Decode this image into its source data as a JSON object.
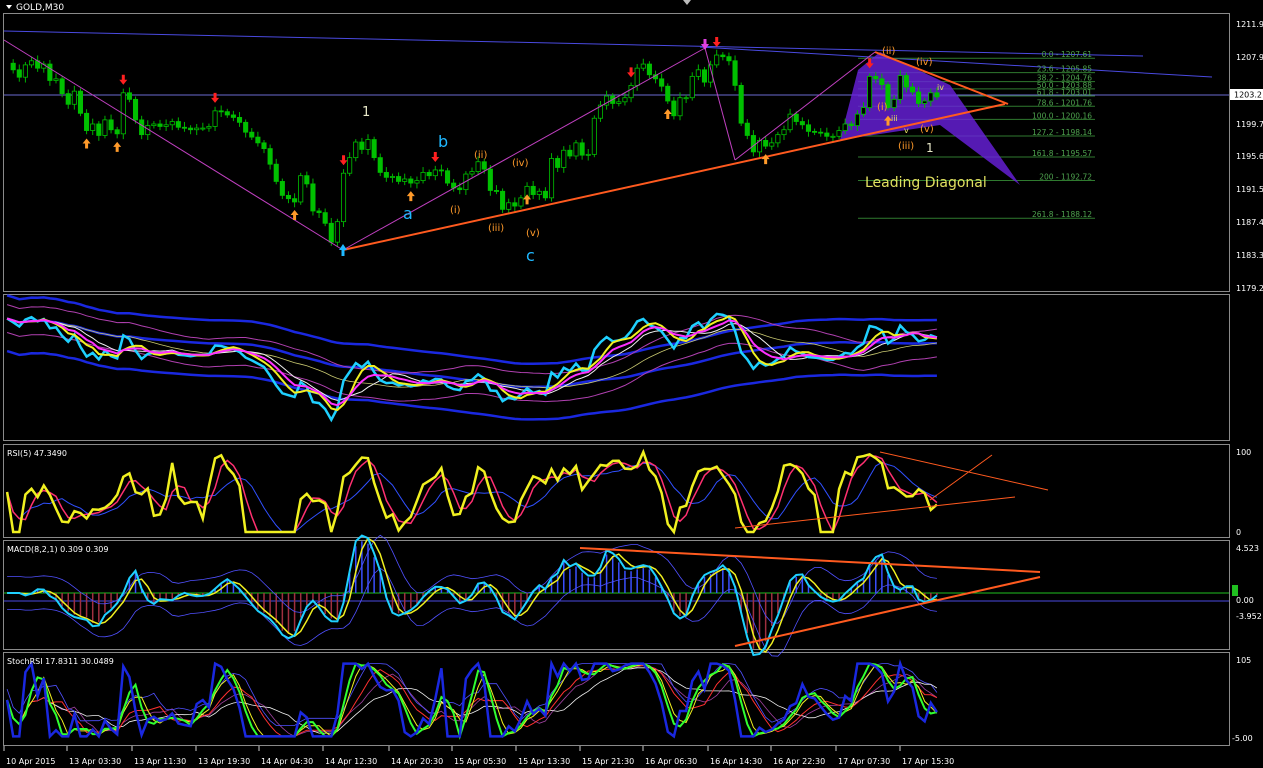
{
  "header": {
    "symbol": "GOLD,M30"
  },
  "price_axis": {
    "ticks": [
      "1211.95",
      "1207.95",
      "1203.2",
      "1199.75",
      "1195.65",
      "1191.55",
      "1187.45",
      "1183.35",
      "1179.25"
    ],
    "current_price": "1203.2"
  },
  "indicators": {
    "rsi": {
      "label": "RSI(5) 47.3490",
      "ticks": [
        "100",
        "0"
      ]
    },
    "macd": {
      "label": "MACD(8,2,1) 0.309 0.309",
      "ticks": [
        "4.523",
        "0.00",
        "-3.952"
      ]
    },
    "stoch": {
      "label": "StochRSI 17.8311 30.0489",
      "ticks": [
        "105",
        "-5.00"
      ]
    }
  },
  "time_axis": {
    "labels": [
      "10 Apr 2015",
      "13 Apr 03:30",
      "13 Apr 11:30",
      "13 Apr 19:30",
      "14 Apr 04:30",
      "14 Apr 12:30",
      "14 Apr 20:30",
      "15 Apr 05:30",
      "15 Apr 13:30",
      "15 Apr 21:30",
      "16 Apr 06:30",
      "16 Apr 14:30",
      "16 Apr 22:30",
      "17 Apr 07:30",
      "17 Apr 15:30"
    ]
  },
  "fib_levels": [
    {
      "label": "0.0 - 1207.61"
    },
    {
      "label": "23.6 - 1205.85"
    },
    {
      "label": "38.2 - 1204.76"
    },
    {
      "label": "50.0 - 1203.88"
    },
    {
      "label": "61.8 - 1203.01"
    },
    {
      "label": "78.6 - 1201.76"
    },
    {
      "label": "100.0 - 1200.16"
    },
    {
      "label": "127.2 - 1198.14"
    },
    {
      "label": "161.8 - 1195.57"
    },
    {
      "label": "200 - 1192.72"
    },
    {
      "label": "261.8 - 1188.12"
    }
  ],
  "wave_labels": {
    "one_a": "1",
    "b": "b",
    "a": "a",
    "c": "c",
    "i": "(i)",
    "ii": "(ii)",
    "iii": "(iii)",
    "iv": "(iv)",
    "v": "(v)",
    "r_ii": "(ii)",
    "r_iv": "(iv)",
    "r_i": "(i)",
    "r_iii": "(iii)",
    "r_v": "(v)",
    "r_one": "1",
    "r_small_iv": "iv",
    "r_small_iii": "iii",
    "r_small_v": "v"
  },
  "annotation": {
    "leading_diagonal": "Leading Diagonal"
  },
  "colors": {
    "background": "#000000",
    "grid_line": "#808080",
    "candle": "#00c000",
    "trendline": "#ff5a1f",
    "channel": "#4a4ae0",
    "wave_cyan": "#1fb8ff",
    "wave_orange": "#ff9a2a",
    "fib": "#3a8a3a",
    "magenta": "#e040e0",
    "yellow": "#f0f020",
    "purple_fill": "#7a2aff"
  },
  "chart_data": {
    "type": "candlestick",
    "symbol": "GOLD",
    "timeframe": "M30",
    "ylim": [
      1179.25,
      1213.0
    ],
    "yticks": [
      1211.95,
      1207.95,
      1203.2,
      1199.75,
      1195.65,
      1191.55,
      1187.45,
      1183.35,
      1179.25
    ],
    "close_path": [
      [
        0,
        1207.0
      ],
      [
        1,
        1206.2
      ],
      [
        2,
        1205.3
      ],
      [
        3,
        1206.8
      ],
      [
        4,
        1207.3
      ],
      [
        5,
        1206.4
      ],
      [
        6,
        1206.9
      ],
      [
        7,
        1204.9
      ],
      [
        8,
        1205.1
      ],
      [
        9,
        1203.3
      ],
      [
        10,
        1202.0
      ],
      [
        11,
        1203.6
      ],
      [
        12,
        1200.9
      ],
      [
        13,
        1198.8
      ],
      [
        14,
        1199.6
      ],
      [
        15,
        1198.2
      ],
      [
        16,
        1200.1
      ],
      [
        17,
        1198.9
      ],
      [
        18,
        1198.4
      ],
      [
        19,
        1203.4
      ],
      [
        20,
        1202.6
      ],
      [
        21,
        1200.1
      ],
      [
        22,
        1198.3
      ],
      [
        23,
        1199.4
      ],
      [
        24,
        1199.6
      ],
      [
        25,
        1199.3
      ],
      [
        26,
        1199.5
      ],
      [
        27,
        1199.9
      ],
      [
        28,
        1199.2
      ],
      [
        29,
        1199.1
      ],
      [
        30,
        1198.9
      ],
      [
        31,
        1199.1
      ],
      [
        32,
        1199.1
      ],
      [
        33,
        1199.3
      ],
      [
        34,
        1201.2
      ],
      [
        35,
        1201.1
      ],
      [
        36,
        1200.7
      ],
      [
        37,
        1200.4
      ],
      [
        38,
        1199.8
      ],
      [
        39,
        1198.6
      ],
      [
        40,
        1198.0
      ],
      [
        41,
        1197.3
      ],
      [
        42,
        1196.6
      ],
      [
        43,
        1194.7
      ],
      [
        44,
        1192.6
      ],
      [
        45,
        1190.9
      ],
      [
        46,
        1190.5
      ],
      [
        47,
        1190.1
      ],
      [
        48,
        1193.3
      ],
      [
        49,
        1192.3
      ],
      [
        50,
        1189.0
      ],
      [
        51,
        1188.8
      ],
      [
        52,
        1187.5
      ],
      [
        53,
        1185.2
      ],
      [
        54,
        1187.7
      ],
      [
        55,
        1193.6
      ],
      [
        56,
        1195.5
      ],
      [
        57,
        1197.4
      ],
      [
        58,
        1196.5
      ],
      [
        59,
        1197.7
      ],
      [
        60,
        1195.5
      ],
      [
        61,
        1193.7
      ],
      [
        62,
        1193.1
      ],
      [
        63,
        1193.2
      ],
      [
        64,
        1192.6
      ],
      [
        65,
        1192.9
      ],
      [
        66,
        1192.4
      ],
      [
        67,
        1192.7
      ],
      [
        68,
        1193.7
      ],
      [
        69,
        1193.3
      ],
      [
        70,
        1194.0
      ],
      [
        71,
        1193.9
      ],
      [
        72,
        1192.4
      ],
      [
        73,
        1191.8
      ],
      [
        74,
        1191.6
      ],
      [
        75,
        1193.5
      ],
      [
        76,
        1193.8
      ],
      [
        77,
        1195.0
      ],
      [
        78,
        1194.1
      ],
      [
        79,
        1191.5
      ],
      [
        80,
        1191.4
      ],
      [
        81,
        1189.2
      ],
      [
        82,
        1190.0
      ],
      [
        83,
        1189.6
      ],
      [
        84,
        1190.6
      ],
      [
        85,
        1192.0
      ],
      [
        86,
        1191.0
      ],
      [
        87,
        1191.4
      ],
      [
        88,
        1190.6
      ],
      [
        89,
        1195.4
      ],
      [
        90,
        1194.3
      ],
      [
        91,
        1196.4
      ],
      [
        92,
        1195.7
      ],
      [
        93,
        1197.3
      ],
      [
        94,
        1195.8
      ],
      [
        95,
        1195.9
      ],
      [
        96,
        1200.3
      ],
      [
        97,
        1201.9
      ],
      [
        98,
        1203.0
      ],
      [
        99,
        1202.1
      ],
      [
        100,
        1202.3
      ],
      [
        101,
        1202.8
      ],
      [
        102,
        1204.3
      ],
      [
        103,
        1206.4
      ],
      [
        104,
        1206.9
      ],
      [
        105,
        1205.6
      ],
      [
        106,
        1205.1
      ],
      [
        107,
        1204.2
      ],
      [
        108,
        1202.4
      ],
      [
        109,
        1200.6
      ],
      [
        110,
        1202.8
      ],
      [
        111,
        1202.8
      ],
      [
        112,
        1205.4
      ],
      [
        113,
        1206.2
      ],
      [
        114,
        1204.7
      ],
      [
        115,
        1206.8
      ],
      [
        116,
        1208.0
      ],
      [
        117,
        1207.8
      ],
      [
        118,
        1207.3
      ],
      [
        119,
        1204.3
      ],
      [
        120,
        1199.7
      ],
      [
        121,
        1198.2
      ],
      [
        122,
        1196.2
      ],
      [
        123,
        1197.6
      ],
      [
        124,
        1196.9
      ],
      [
        125,
        1197.3
      ],
      [
        126,
        1198.3
      ],
      [
        127,
        1198.9
      ],
      [
        128,
        1200.8
      ],
      [
        129,
        1199.9
      ],
      [
        130,
        1199.5
      ],
      [
        131,
        1198.7
      ],
      [
        132,
        1198.6
      ],
      [
        133,
        1198.5
      ],
      [
        134,
        1198.1
      ],
      [
        135,
        1198.1
      ],
      [
        136,
        1198.8
      ],
      [
        137,
        1199.6
      ],
      [
        138,
        1199.4
      ],
      [
        139,
        1200.8
      ],
      [
        140,
        1201.6
      ],
      [
        141,
        1205.4
      ],
      [
        142,
        1205.1
      ],
      [
        143,
        1204.4
      ],
      [
        144,
        1201.6
      ],
      [
        145,
        1202.6
      ],
      [
        146,
        1205.5
      ],
      [
        147,
        1204.1
      ],
      [
        148,
        1203.5
      ],
      [
        149,
        1202.1
      ],
      [
        150,
        1202.4
      ],
      [
        151,
        1203.4
      ],
      [
        152,
        1202.9
      ]
    ],
    "bars_total": 153,
    "fib_retracement": [
      {
        "level": 0.0,
        "price": 1207.61
      },
      {
        "level": 23.6,
        "price": 1205.85
      },
      {
        "level": 38.2,
        "price": 1204.76
      },
      {
        "level": 50.0,
        "price": 1203.88
      },
      {
        "level": 61.8,
        "price": 1203.01
      },
      {
        "level": 78.6,
        "price": 1201.76
      },
      {
        "level": 100.0,
        "price": 1200.16
      },
      {
        "level": 127.2,
        "price": 1198.14
      },
      {
        "level": 161.8,
        "price": 1195.57
      },
      {
        "level": 200,
        "price": 1192.72
      },
      {
        "level": 261.8,
        "price": 1188.12
      }
    ],
    "rsi": {
      "period": 5,
      "value": 47.349,
      "ylim": [
        0,
        100
      ]
    },
    "macd": {
      "params": [
        8,
        2,
        1
      ],
      "value": 0.309,
      "signal": 0.309,
      "ylim": [
        -3.952,
        4.523
      ]
    },
    "stochrsi": {
      "k": 17.8311,
      "d": 30.0489,
      "ylim": [
        -5,
        105
      ]
    }
  }
}
